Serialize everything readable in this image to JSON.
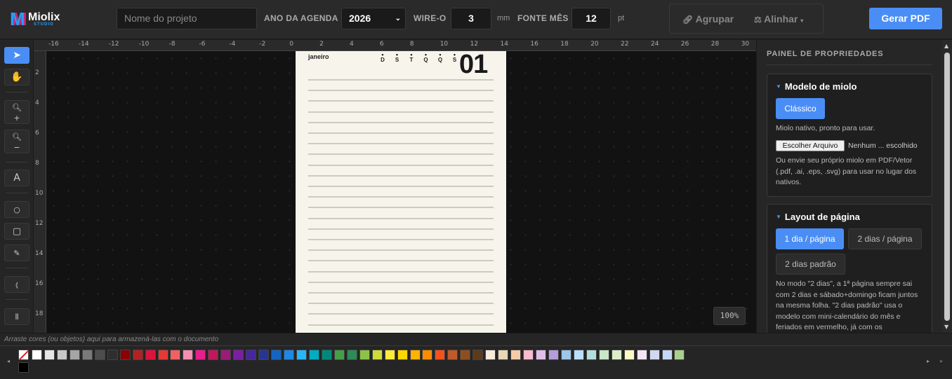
{
  "header": {
    "logo_text": "Miolix",
    "logo_sub": "STUDIO",
    "project_name_placeholder": "Nome do projeto",
    "agenda_year_label": "ANO DA AGENDA",
    "agenda_year_value": "2026",
    "wireo_label": "WIRE-O",
    "wireo_value": "3",
    "wireo_unit": "mm",
    "font_month_label": "FONTE MÊS",
    "font_month_value": "12",
    "font_month_unit": "pt",
    "group_label": "Agrupar",
    "align_label": "Alinhar",
    "generate_label": "Gerar PDF"
  },
  "tools": [
    {
      "name": "select-tool",
      "icon": "cursor-arrow-icon",
      "glyph": "➤",
      "active": true
    },
    {
      "name": "pan-tool",
      "icon": "hand-icon",
      "glyph": "✋",
      "active": false
    },
    {
      "name": "zoom-in-tool",
      "icon": "zoom-in-icon",
      "glyph": "🔍+",
      "active": false
    },
    {
      "name": "zoom-out-tool",
      "icon": "zoom-out-icon",
      "glyph": "🔍−",
      "active": false
    },
    {
      "name": "text-tool",
      "icon": "text-icon",
      "glyph": "A",
      "active": false
    },
    {
      "name": "ellipse-tool",
      "icon": "circle-icon",
      "glyph": "○",
      "active": false
    },
    {
      "name": "rectangle-tool",
      "icon": "rectangle-icon",
      "glyph": "▢",
      "active": false
    },
    {
      "name": "pen-tool",
      "icon": "pen-icon",
      "glyph": "✎",
      "active": false
    },
    {
      "name": "curve-tool",
      "icon": "curve-icon",
      "glyph": "⦅",
      "active": false
    },
    {
      "name": "line-tool",
      "icon": "lines-icon",
      "glyph": "⫴",
      "active": false
    }
  ],
  "ruler": {
    "top_ticks": [
      "-16",
      "-14",
      "-12",
      "-10",
      "-8",
      "-6",
      "-4",
      "-2",
      "0",
      "2",
      "4",
      "6",
      "8",
      "10",
      "12",
      "14",
      "16",
      "18",
      "20",
      "22",
      "24",
      "26",
      "28",
      "30"
    ],
    "left_ticks": [
      "2",
      "4",
      "6",
      "8",
      "10",
      "12",
      "14",
      "16",
      "18"
    ]
  },
  "page": {
    "month": "janeiro",
    "weekdays": [
      "D",
      "S",
      "T",
      "Q",
      "Q",
      "S"
    ],
    "day_number": "01"
  },
  "zoom_level": "100%",
  "panel": {
    "title": "PAINEL DE PROPRIEDADES",
    "model": {
      "heading": "Modelo de miolo",
      "classic_button": "Clássico",
      "classic_desc": "Miolo nativo, pronto para usar.",
      "file_button": "Escolher Arquivo",
      "file_status": "Nenhum ... escolhido",
      "upload_desc": "Ou envie seu próprio miolo em PDF/Vetor (.pdf, .ai, .eps, .svg) para usar no lugar dos nativos."
    },
    "layout": {
      "heading": "Layout de página",
      "opt1": "1 dia / página",
      "opt2": "2 dias / página",
      "opt3": "2 dias padrão",
      "desc": "No modo \"2 dias\", a 1ª página sempre sai com 2 dias e sábado+domingo ficam juntos na mesma folha. \"2 dias padrão\" usa o modelo com mini-calendário do mês e feriados em vermelho, já com os"
    }
  },
  "palette": {
    "hint": "Arraste cores (ou objetos) aqui para armazená-las com o documento",
    "colors": [
      "#ffffff",
      "#e6e6e6",
      "#c8c8c8",
      "#a5a5a5",
      "#7a7a7a",
      "#4d4d4d",
      "#2e2e2e",
      "#8b0000",
      "#b22222",
      "#dc143c",
      "#e53935",
      "#f06262",
      "#f48fb1",
      "#e91e8c",
      "#c2185b",
      "#9c1a7a",
      "#7b1fa2",
      "#4527a0",
      "#283593",
      "#1565c0",
      "#1e88e5",
      "#29b6f6",
      "#00acc1",
      "#00897b",
      "#43a047",
      "#2e8b57",
      "#8bc34a",
      "#cddc39",
      "#ffeb3b",
      "#ffd600",
      "#ffb300",
      "#fb8c00",
      "#f4511e",
      "#bf5a2a",
      "#8d4f1f",
      "#5d3a1a",
      "#f5ecdc",
      "#ead7b7",
      "#f5cba7",
      "#f8bbd0",
      "#e1bee7",
      "#b39ddb",
      "#9fc5e8",
      "#bbdefb",
      "#b2dfdb",
      "#c8e6c9",
      "#dcedc8",
      "#fff9c4",
      "#f3e5f5",
      "#d1d9f0",
      "#c5d8f5",
      "#a9d18e"
    ]
  }
}
